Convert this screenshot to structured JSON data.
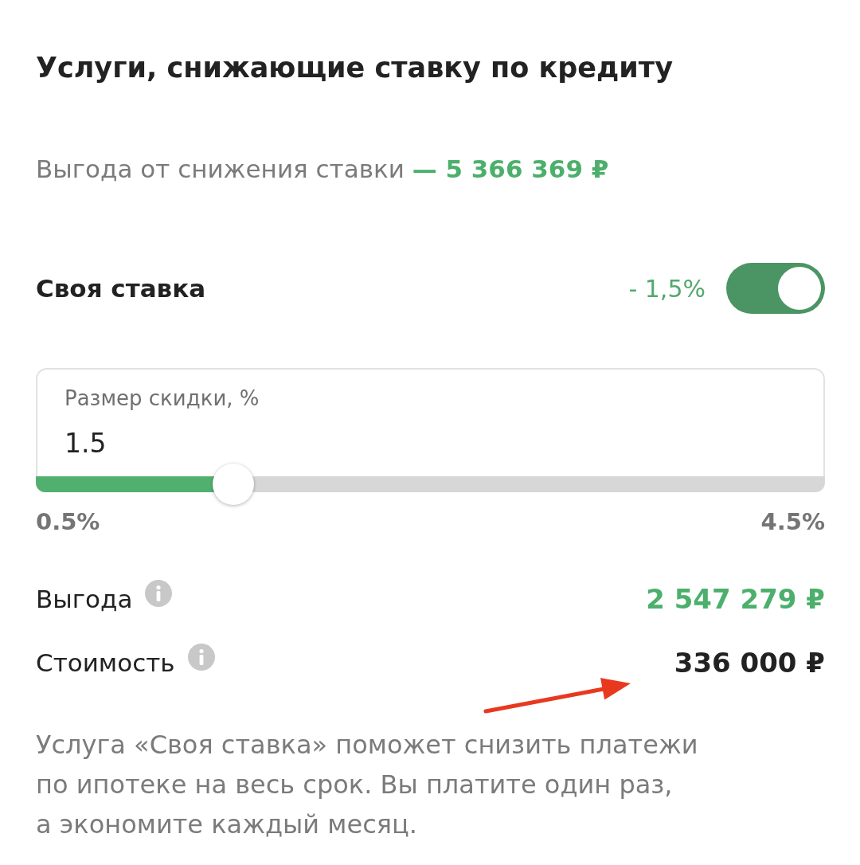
{
  "title": "Услуги, снижающие ставку по кредиту",
  "savings_summary": "Выгода от снижения ставки **— 5 366 369 ₽**",
  "service": {
    "name": "Своя ставка",
    "rate_change": "- 1,5%",
    "on": true
  },
  "discount_field": {
    "label": "Размер скидки, %",
    "value": "1.5"
  },
  "slider": {
    "level": 0.25,
    "min_label": "0.5%",
    "max_label": "4.5%"
  },
  "details": [
    {
      "kind": "benefit",
      "label": "Выгода",
      "value": "2 547 279 ₽"
    },
    {
      "kind": "cost",
      "label": "Стоимость",
      "value": "336 000 ₽"
    }
  ],
  "description": "Услуга «Своя ставка» поможет снизить платежи\nпо ипотеке на весь срок. Вы платите один раз,\nа экономите каждый месяц.",
  "annotations": [
    {
      "kind": "arrow"
    }
  ]
}
